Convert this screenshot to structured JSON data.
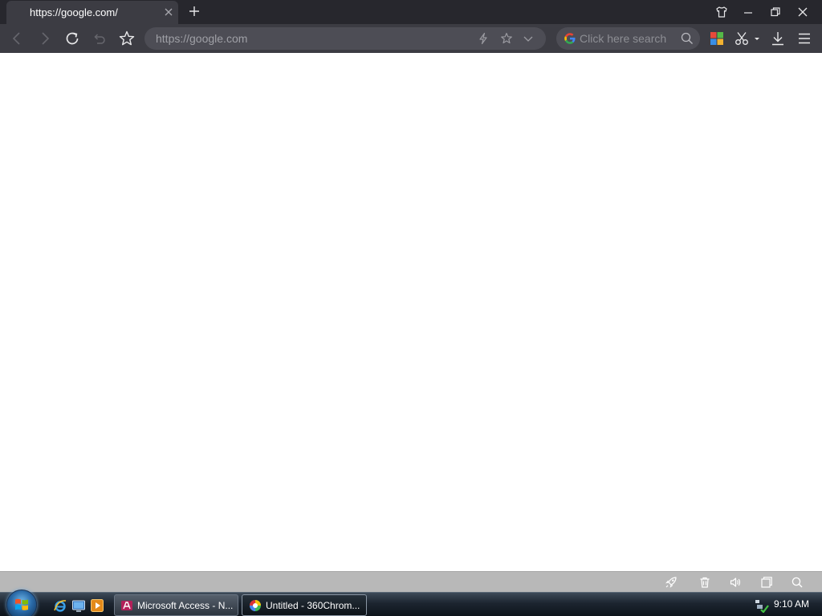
{
  "browser": {
    "tab": {
      "title": "https://google.com/"
    },
    "address_bar": {
      "value": "https://google.com"
    },
    "search": {
      "placeholder": "Click here search"
    }
  },
  "taskbar": {
    "tasks": [
      {
        "label": "Microsoft Access - N..."
      },
      {
        "label": "Untitled - 360Chrom..."
      }
    ],
    "clock": "9:10 AM"
  },
  "colors": {
    "tabstrip": "#27272d",
    "toolbar": "#3c3c43",
    "omnibox": "#4d4d55",
    "statusbar": "#b8b8b8",
    "content": "#ffffff"
  },
  "icons": [
    "close-icon",
    "plus-icon",
    "shirt-icon",
    "minimize-icon",
    "restore-icon",
    "back-icon",
    "forward-icon",
    "reload-icon",
    "undo-icon",
    "star-icon",
    "lightning-icon",
    "chevron-down-icon",
    "google-icon",
    "search-icon",
    "apps-grid-icon",
    "scissors-icon",
    "download-icon",
    "menu-icon",
    "rocket-icon",
    "trash-icon",
    "speaker-icon",
    "window-icon",
    "magnifier-icon",
    "windows-logo-icon",
    "ie-icon",
    "show-desktop-icon",
    "media-player-icon",
    "access-icon",
    "360-browser-icon",
    "network-icon",
    "shield-check-icon"
  ]
}
